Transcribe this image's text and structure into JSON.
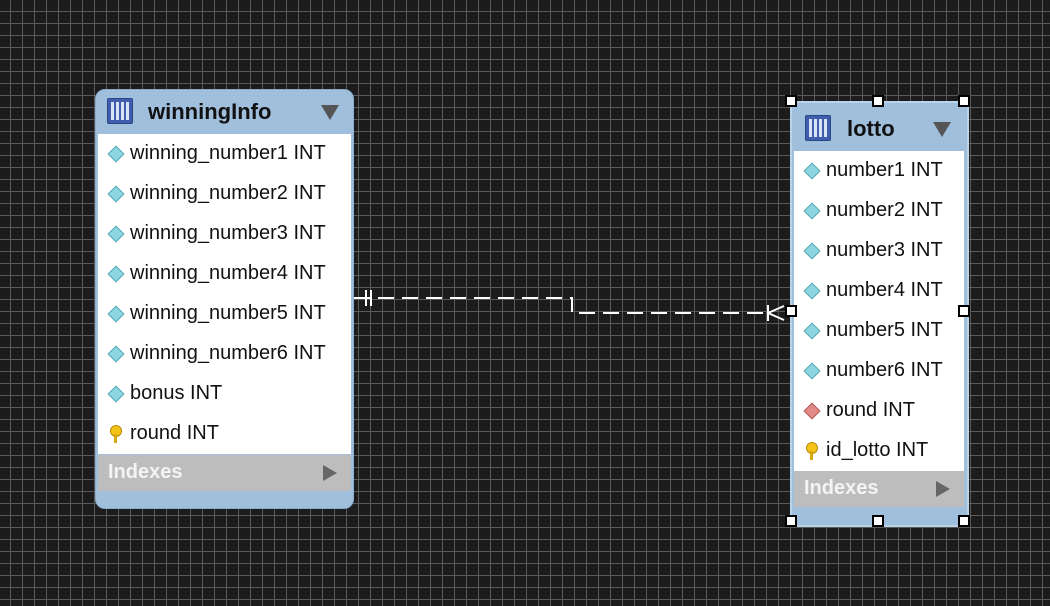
{
  "tables": {
    "winning": {
      "name": "winningInfo",
      "columns": [
        {
          "label": "winning_number1 INT",
          "icon": "diamond-icon"
        },
        {
          "label": "winning_number2 INT",
          "icon": "diamond-icon"
        },
        {
          "label": "winning_number3 INT",
          "icon": "diamond-icon"
        },
        {
          "label": "winning_number4 INT",
          "icon": "diamond-icon"
        },
        {
          "label": "winning_number5 INT",
          "icon": "diamond-icon"
        },
        {
          "label": "winning_number6 INT",
          "icon": "diamond-icon"
        },
        {
          "label": "bonus INT",
          "icon": "diamond-icon"
        },
        {
          "label": "round INT",
          "icon": "primary-key-icon"
        }
      ],
      "indexes_label": "Indexes"
    },
    "lotto": {
      "name": "lotto",
      "columns": [
        {
          "label": "number1 INT",
          "icon": "diamond-icon"
        },
        {
          "label": "number2 INT",
          "icon": "diamond-icon"
        },
        {
          "label": "number3 INT",
          "icon": "diamond-icon"
        },
        {
          "label": "number4 INT",
          "icon": "diamond-icon"
        },
        {
          "label": "number5 INT",
          "icon": "diamond-icon"
        },
        {
          "label": "number6 INT",
          "icon": "diamond-icon"
        },
        {
          "label": "round INT",
          "icon": "foreign-key-icon"
        },
        {
          "label": "id_lotto INT",
          "icon": "primary-key-icon"
        }
      ],
      "indexes_label": "Indexes"
    }
  },
  "relationship": {
    "from": "winningInfo",
    "to": "lotto",
    "from_cardinality": "one",
    "to_cardinality": "many"
  }
}
